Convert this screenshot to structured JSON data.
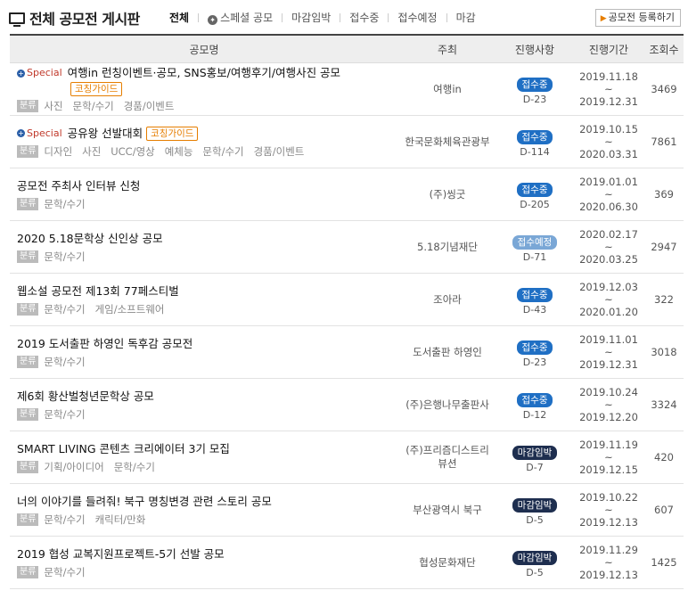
{
  "header": {
    "title": "전체 공모전 게시판",
    "tabs": [
      {
        "label": "전체"
      },
      {
        "label": "스페셜 공모",
        "icon": "star-icon"
      },
      {
        "label": "마감임박"
      },
      {
        "label": "접수중"
      },
      {
        "label": "접수예정"
      },
      {
        "label": "마감"
      }
    ],
    "register_label": "공모전 등록하기"
  },
  "table": {
    "columns": [
      "공모명",
      "주최",
      "진행사항",
      "진행기간",
      "조회수"
    ],
    "category_label": "분류",
    "special_label": "Special",
    "coach_label": "코칭가이드",
    "rows": [
      {
        "title": "여행in 런칭이벤트·공모, SNS홍보/여행후기/여행사진 공모",
        "special": true,
        "coach": true,
        "coach_wrap": true,
        "tags": "사진   문학/수기   경품/이벤트",
        "host": "여행in",
        "status": "접수중",
        "status_type": "open",
        "dday": "D-23",
        "start": "2019.11.18",
        "end": "2019.12.31",
        "views": "3469"
      },
      {
        "title": "공유왕 선발대회",
        "special": true,
        "coach": true,
        "coach_wrap": false,
        "tags": "디자인   사진   UCC/영상   예체능   문학/수기   경품/이벤트",
        "host": "한국문화체육관광부",
        "status": "접수중",
        "status_type": "open",
        "dday": "D-114",
        "start": "2019.10.15",
        "end": "2020.03.31",
        "views": "7861"
      },
      {
        "title": "공모전 주최사 인터뷰 신청",
        "special": false,
        "coach": false,
        "tags": "문학/수기",
        "host": "(주)씽굿",
        "status": "접수중",
        "status_type": "open",
        "dday": "D-205",
        "start": "2019.01.01",
        "end": "2020.06.30",
        "views": "369"
      },
      {
        "title": "2020 5.18문학상 신인상 공모",
        "special": false,
        "coach": false,
        "tags": "문학/수기",
        "host": "5.18기념재단",
        "status": "접수예정",
        "status_type": "soon",
        "dday": "D-71",
        "start": "2020.02.17",
        "end": "2020.03.25",
        "views": "2947"
      },
      {
        "title": "웹소설 공모전 제13회 77페스티벌",
        "special": false,
        "coach": false,
        "tags": "문학/수기   게임/소프트웨어",
        "host": "조아라",
        "status": "접수중",
        "status_type": "open",
        "dday": "D-43",
        "start": "2019.12.03",
        "end": "2020.01.20",
        "views": "322"
      },
      {
        "title": "2019 도서출판 하영인 독후감 공모전",
        "special": false,
        "coach": false,
        "tags": "문학/수기",
        "host": "도서출판 하영인",
        "status": "접수중",
        "status_type": "open",
        "dday": "D-23",
        "start": "2019.11.01",
        "end": "2019.12.31",
        "views": "3018"
      },
      {
        "title": "제6회 황산벌청년문학상 공모",
        "special": false,
        "coach": false,
        "tags": "문학/수기",
        "host": "(주)은행나무출판사",
        "status": "접수중",
        "status_type": "open",
        "dday": "D-12",
        "start": "2019.10.24",
        "end": "2019.12.20",
        "views": "3324"
      },
      {
        "title": "SMART LIVING 콘텐츠 크리에이터 3기 모집",
        "special": false,
        "coach": false,
        "tags": "기획/아이디어   문학/수기",
        "host": "(주)프리즘디스트리뷰션",
        "status": "마감임박",
        "status_type": "close",
        "dday": "D-7",
        "start": "2019.11.19",
        "end": "2019.12.15",
        "views": "420"
      },
      {
        "title": "너의 이야기를 들려줘! 북구 명칭변경 관련 스토리 공모",
        "special": false,
        "coach": false,
        "tags": "문학/수기   캐릭터/만화",
        "host": "부산광역시 북구",
        "status": "마감임박",
        "status_type": "close",
        "dday": "D-5",
        "start": "2019.10.22",
        "end": "2019.12.13",
        "views": "607"
      },
      {
        "title": "2019 협성 교복지원프로젝트-5기 선발 공모",
        "special": false,
        "coach": false,
        "tags": "문학/수기",
        "host": "협성문화재단",
        "status": "마감임박",
        "status_type": "close",
        "dday": "D-5",
        "start": "2019.11.29",
        "end": "2019.12.13",
        "views": "1425"
      }
    ]
  }
}
